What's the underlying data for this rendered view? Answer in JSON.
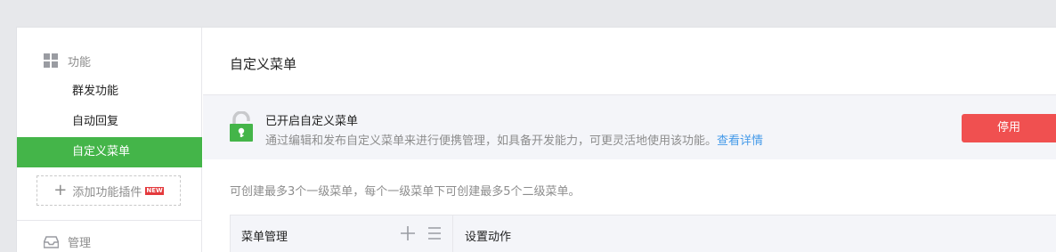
{
  "sidebar": {
    "function_section": {
      "label": "功能",
      "icon": "grid-icon"
    },
    "items": [
      {
        "label": "群发功能",
        "active": false
      },
      {
        "label": "自动回复",
        "active": false
      },
      {
        "label": "自定义菜单",
        "active": true
      }
    ],
    "add_plugin": {
      "label": "添加功能插件",
      "badge": "NEW"
    },
    "manage_section": {
      "label": "管理",
      "icon": "inbox-tray-icon"
    }
  },
  "main": {
    "title": "自定义菜单",
    "notice": {
      "title": "已开启自定义菜单",
      "description": "通过编辑和发布自定义菜单来进行便携管理，如具备开发能力，可更灵活地使用该功能。",
      "link": "查看详情",
      "icon": "unlocked-lock-icon"
    },
    "stop_button": "停用",
    "hint": "可创建最多3个一级菜单，每个一级菜单下可创建最多5个二级菜单。",
    "table": {
      "col_menu": "菜单管理",
      "col_action": "设置动作",
      "add_icon": "plus-icon",
      "sort_icon": "sort-list-icon"
    }
  },
  "colors": {
    "accent_green": "#44b549",
    "danger_red": "#f05050",
    "link_blue": "#459ae9",
    "badge_red": "#e4393c"
  }
}
